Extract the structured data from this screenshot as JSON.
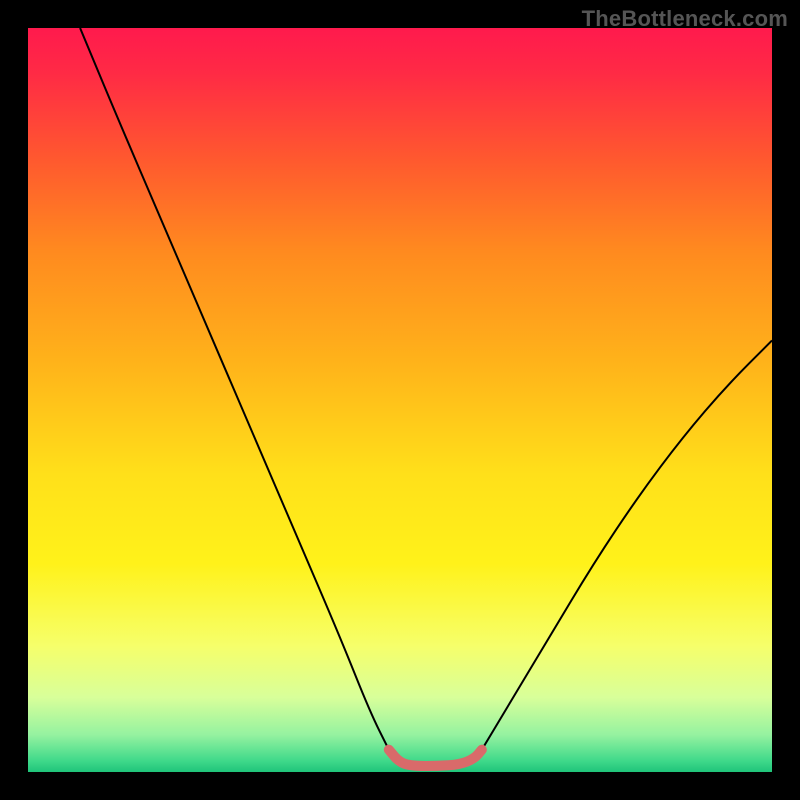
{
  "watermark": "TheBottleneck.com",
  "chart_data": {
    "type": "line",
    "title": "",
    "xlabel": "",
    "ylabel": "",
    "xlim": [
      0,
      100
    ],
    "ylim": [
      0,
      100
    ],
    "gradient_stops": [
      {
        "offset": 0.0,
        "color": "#ff1a4d"
      },
      {
        "offset": 0.06,
        "color": "#ff2a45"
      },
      {
        "offset": 0.18,
        "color": "#ff5a2e"
      },
      {
        "offset": 0.3,
        "color": "#ff8a1f"
      },
      {
        "offset": 0.45,
        "color": "#ffb31a"
      },
      {
        "offset": 0.6,
        "color": "#ffe01a"
      },
      {
        "offset": 0.72,
        "color": "#fff21a"
      },
      {
        "offset": 0.83,
        "color": "#f6ff6a"
      },
      {
        "offset": 0.9,
        "color": "#d8ff9a"
      },
      {
        "offset": 0.95,
        "color": "#95f2a0"
      },
      {
        "offset": 0.985,
        "color": "#3fd98a"
      },
      {
        "offset": 1.0,
        "color": "#1fc47a"
      }
    ],
    "series": [
      {
        "name": "curve-left",
        "style": {
          "stroke": "#000000",
          "width": 2.0
        },
        "points": [
          {
            "x": 7.0,
            "y": 100.0
          },
          {
            "x": 12.0,
            "y": 88.0
          },
          {
            "x": 18.0,
            "y": 74.0
          },
          {
            "x": 24.0,
            "y": 60.0
          },
          {
            "x": 30.0,
            "y": 46.0
          },
          {
            "x": 36.0,
            "y": 32.0
          },
          {
            "x": 42.0,
            "y": 18.0
          },
          {
            "x": 46.0,
            "y": 8.0
          },
          {
            "x": 48.5,
            "y": 3.0
          }
        ]
      },
      {
        "name": "curve-right",
        "style": {
          "stroke": "#000000",
          "width": 2.0
        },
        "points": [
          {
            "x": 61.0,
            "y": 3.0
          },
          {
            "x": 64.0,
            "y": 8.0
          },
          {
            "x": 70.0,
            "y": 18.0
          },
          {
            "x": 76.0,
            "y": 28.0
          },
          {
            "x": 82.0,
            "y": 37.0
          },
          {
            "x": 88.0,
            "y": 45.0
          },
          {
            "x": 94.0,
            "y": 52.0
          },
          {
            "x": 100.0,
            "y": 58.0
          }
        ]
      },
      {
        "name": "flat-segment",
        "style": {
          "stroke": "#d96a6a",
          "width": 10.0,
          "cap": "round"
        },
        "points": [
          {
            "x": 48.5,
            "y": 3.0
          },
          {
            "x": 50.0,
            "y": 1.2
          },
          {
            "x": 52.0,
            "y": 0.8
          },
          {
            "x": 55.0,
            "y": 0.8
          },
          {
            "x": 58.0,
            "y": 1.0
          },
          {
            "x": 60.0,
            "y": 1.8
          },
          {
            "x": 61.0,
            "y": 3.0
          }
        ]
      }
    ],
    "annotations": []
  }
}
